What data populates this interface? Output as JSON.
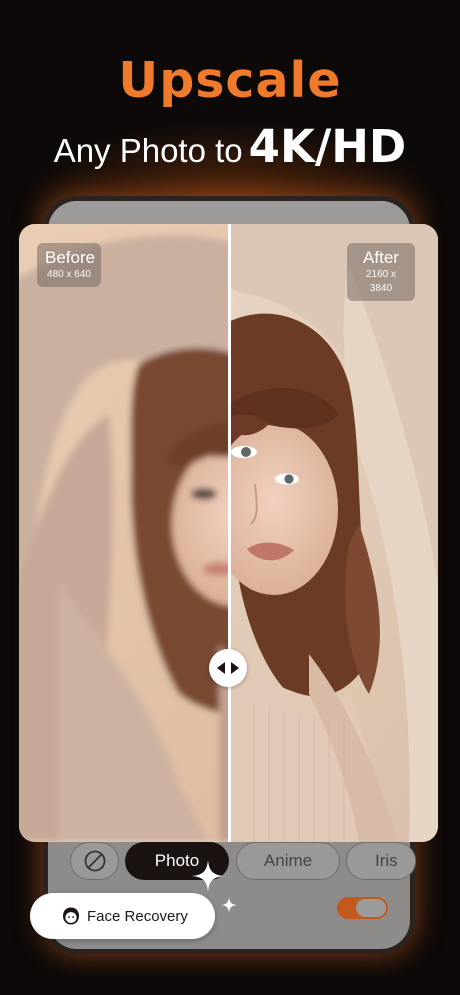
{
  "headline": "Upscale",
  "subhead": {
    "lead": "Any Photo to",
    "emphasis": "4K/HD"
  },
  "compare": {
    "before": {
      "label": "Before",
      "resolution": "480 x 640"
    },
    "after": {
      "label": "After",
      "resolution": "2160 x 3840"
    }
  },
  "modes": {
    "none_icon": "no-filter-icon",
    "items": [
      "Photo",
      "Anime",
      "Iris"
    ],
    "selected": "Photo"
  },
  "face_recovery": {
    "label": "Face Recovery",
    "icon": "face-icon",
    "enabled": true
  },
  "colors": {
    "accent": "#f07a2c",
    "toggle_on": "#c35a1d"
  }
}
